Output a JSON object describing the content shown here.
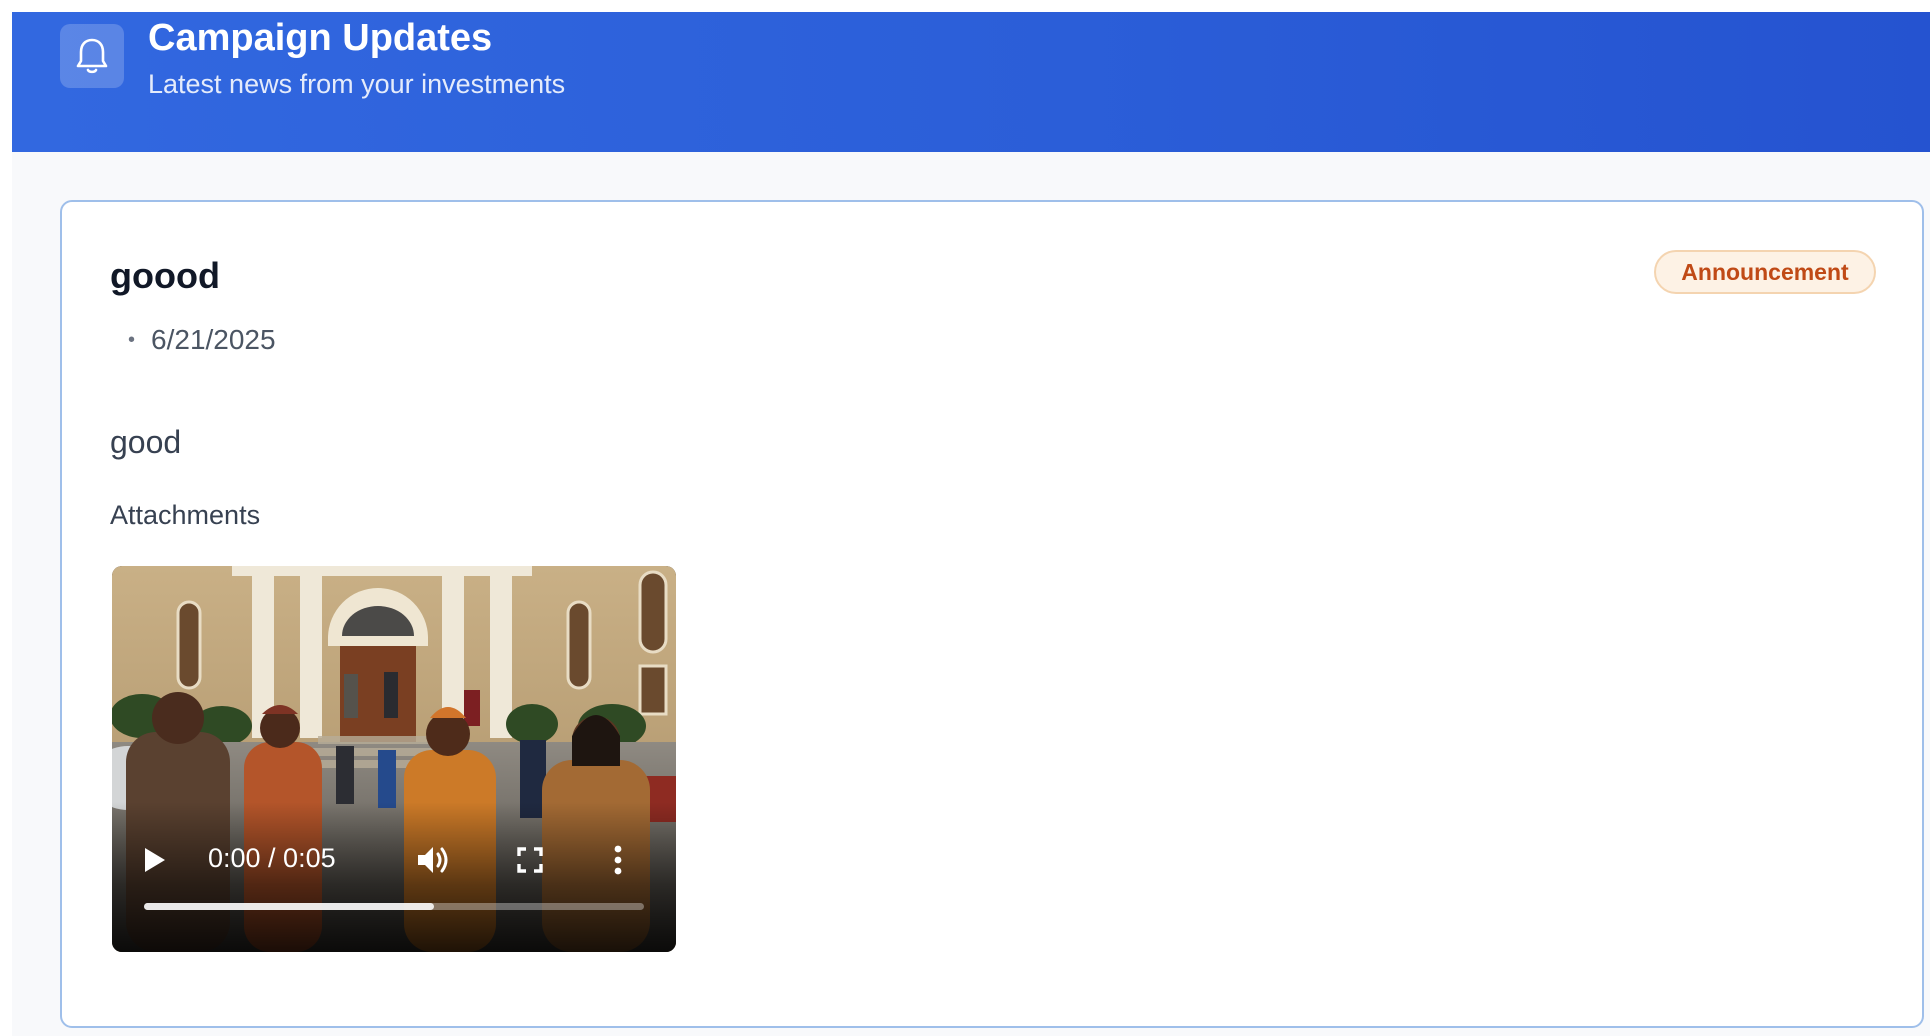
{
  "header": {
    "title": "Campaign Updates",
    "subtitle": "Latest news from your investments",
    "icon": "bell-icon",
    "background_color": "#2b5ed8"
  },
  "update": {
    "title": "goood",
    "category_badge": "Announcement",
    "separator": "•",
    "date": "6/21/2025",
    "body": "good",
    "attachments_label": "Attachments",
    "badge_colors": {
      "text": "#c04a16",
      "background": "#fdf2e5",
      "border": "#f4d4b0"
    }
  },
  "video": {
    "time": "0:00 / 0:05",
    "buffered_fraction": 0.58,
    "controls": {
      "play": "play-icon",
      "volume": "volume-icon",
      "fullscreen": "fullscreen-icon",
      "more": "more-options-icon"
    }
  }
}
